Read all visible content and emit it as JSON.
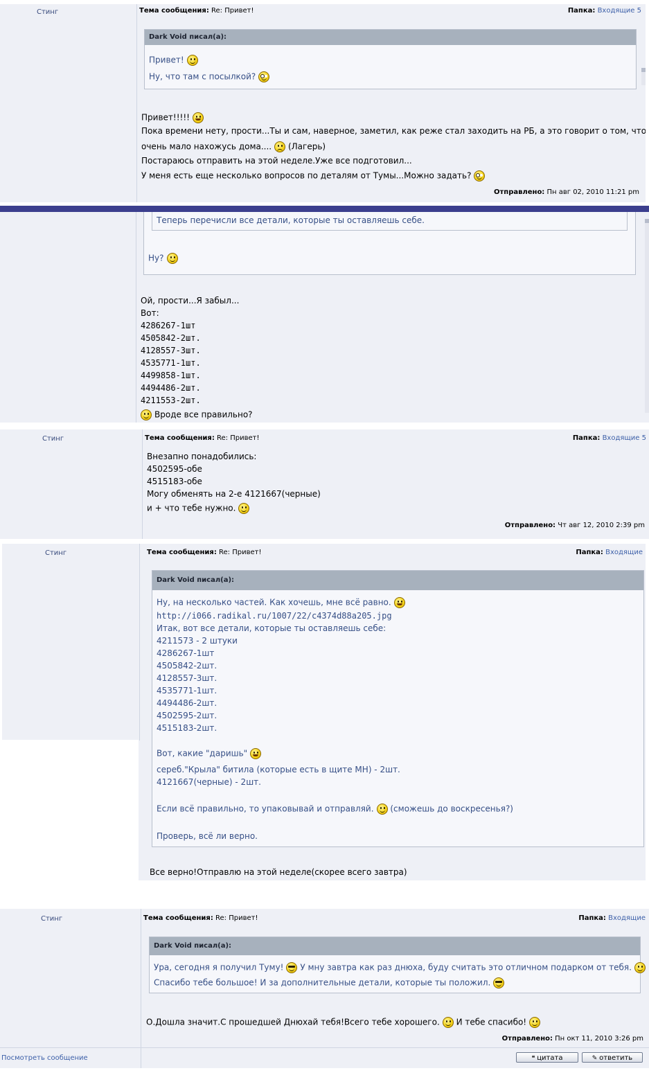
{
  "post1": {
    "author": "Стинг",
    "subject_label": "Тема сообщения:",
    "subject": "Re: Привет!",
    "folder_label": "Папка:",
    "folder": "Входящие 5",
    "quote_author": "Dark Void писал(а):",
    "quote_lines": [
      "Привет!",
      "Ну, что там с посылкой?"
    ],
    "lines": [
      "Привет!!!!!",
      "Пока времени нету, прости...Ты и сам, наверное, заметил, как реже стал заходить на РБ, а это говорит о том, что я",
      "очень мало нахожусь дома....",
      "(Лагерь)",
      "Постараюсь отправить на этой неделе.Уже все подготовил...",
      "У меня есть еще несколько вопросов по деталям от Тумы...Можно задать?"
    ],
    "posted_label": "Отправлено:",
    "posted": "Пн авг 02, 2010 11:21 pm"
  },
  "post2": {
    "quote_inner": "Теперь перечисли все детали, которые ты оставляешь себе.",
    "quote_tail": "Ну?",
    "lines": [
      "Ой, прости...Я забыл...",
      "Вот:",
      "4286267-1шт",
      "4505842-2шт.",
      "4128557-3шт.",
      "4535771-1шт.",
      "4499858-1шт.",
      "4494486-2шт.",
      "4211553-2шт."
    ],
    "last_line": "Вроде все правильно?"
  },
  "post3": {
    "author": "Стинг",
    "subject_label": "Тема сообщения:",
    "subject": "Re: Привет!",
    "folder_label": "Папка:",
    "folder": "Входящие 5",
    "lines": [
      "Внезапно понадобились:",
      "4502595-обе",
      "4515183-обе",
      "Могу обменять на 2-е 4121667(черные)",
      "и + что тебе нужно."
    ],
    "posted_label": "Отправлено:",
    "posted": "Чт авг 12, 2010 2:39 pm"
  },
  "post4": {
    "author": "Стинг",
    "subject_label": "Тема сообщения:",
    "subject": "Re: Привет!",
    "folder_label": "Папка:",
    "folder": "Входящие",
    "quote_author": "Dark Void писал(а):",
    "quote_lines": [
      "Ну, на несколько частей. Как хочешь, мне всё равно.",
      "http://i066.radikal.ru/1007/22/c4374d88a205.jpg",
      "Итак, вот все детали, которые ты оставляешь себе:",
      "4211573 - 2 штуки",
      "4286267-1шт",
      "4505842-2шт.",
      "4128557-3шт.",
      "4535771-1шт.",
      "4494486-2шт.",
      "4502595-2шт.",
      "4515183-2шт.",
      "Вот, какие \"даришь\"",
      "сереб.\"Крыла\" битила (которые есть в щите МН) - 2шт.",
      "4121667(черные) - 2шт.",
      "Если всё правильно, то упаковывай и отправляй.",
      "(сможешь до воскресенья?)",
      "Проверь, всё ли верно."
    ],
    "reply": "Все верно!Отправлю на этой неделе(скорее всего завтра)"
  },
  "post5": {
    "author": "Стинг",
    "subject_label": "Тема сообщения:",
    "subject": "Re: Привет!",
    "folder_label": "Папка:",
    "folder": "Входящие",
    "quote_author": "Dark Void писал(а):",
    "quote_lines": [
      "Ура, сегодня я получил Туму!",
      "У мну завтра как раз днюха, буду считать это отличном подарком от тебя.",
      "Спасибо тебе большое! И за дополнительные детали, которые ты положил."
    ],
    "reply": "О.Дошла значит.С прошедшей Днюхай тебя!Всего тебе хорошего.",
    "reply_tail": "И тебе спасибо!",
    "posted_label": "Отправлено:",
    "posted": "Пн окт 11, 2010 3:26 pm",
    "view_link": "Посмотреть сообщение",
    "quote_button": "цитата",
    "reply_button": "ответить"
  }
}
